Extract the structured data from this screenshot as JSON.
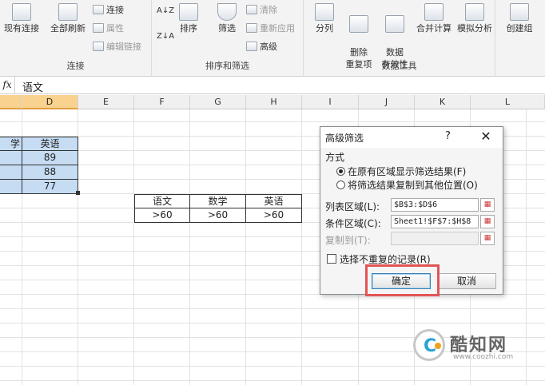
{
  "ribbon": {
    "connect_group": {
      "existing_conn": "现有连接",
      "refresh_all": "全部刷新",
      "connections": "连接",
      "properties": "属性",
      "edit_links": "编辑链接",
      "label": "连接"
    },
    "sort_group": {
      "sort_az": "A↓Z",
      "sort_za": "Z↓A",
      "sort": "排序",
      "filter": "筛选",
      "clear": "清除",
      "reapply": "重新应用",
      "advanced": "高级",
      "label": "排序和筛选"
    },
    "tools_group": {
      "split": "分列",
      "remove_dup": "删除\n重复项",
      "validation": "数据\n有效性",
      "consolidate": "合并计算",
      "whatif": "模拟分析",
      "label": "数据工具"
    },
    "outline_group": {
      "group": "创建组"
    }
  },
  "formula_bar": {
    "fx": "fx",
    "value": "语文"
  },
  "columns": [
    "D",
    "E",
    "F",
    "G",
    "H",
    "I",
    "J",
    "K",
    "L"
  ],
  "sheet": {
    "left_table": {
      "header_partial": "学",
      "header_d": "英语",
      "values": [
        "89",
        "88",
        "77"
      ]
    },
    "criteria_table": {
      "headers": [
        "语文",
        "数学",
        "英语"
      ],
      "values": [
        ">60",
        ">60",
        ">60"
      ]
    }
  },
  "dialog": {
    "title": "高级筛选",
    "help": "?",
    "close": "✕",
    "method_label": "方式",
    "option_inplace": "在原有区域显示筛选结果(F)",
    "option_copy": "将筛选结果复制到其他位置(O)",
    "list_range_label": "列表区域(L):",
    "list_range_value": "$B$3:$D$6",
    "criteria_range_label": "条件区域(C):",
    "criteria_range_value": "Sheet1!$F$7:$H$8",
    "copy_to_label": "复制到(T):",
    "copy_to_value": "",
    "unique_label": "选择不重复的记录(R)",
    "ok": "确定",
    "cancel": "取消"
  },
  "watermark": {
    "name": "酷知网",
    "url": "www.coozhi.com"
  },
  "colors": {
    "selected_header": "#f8d28e",
    "selected_cells": "#c6dcf3",
    "highlight_box": "#e25555"
  }
}
